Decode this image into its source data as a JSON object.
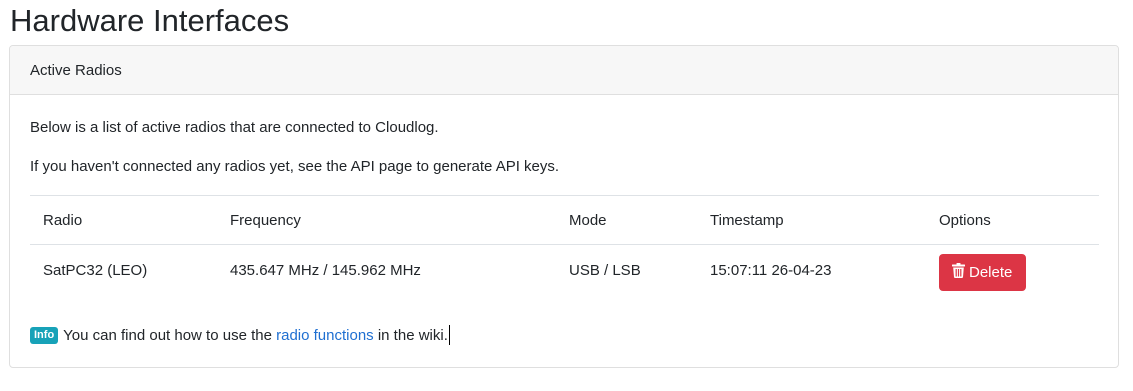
{
  "page": {
    "title": "Hardware Interfaces"
  },
  "card": {
    "header": "Active Radios",
    "intro": "Below is a list of active radios that are connected to Cloudlog.",
    "hint": "If you haven't connected any radios yet, see the API page to generate API keys."
  },
  "table": {
    "headers": [
      "Radio",
      "Frequency",
      "Mode",
      "Timestamp",
      "Options"
    ],
    "rows": [
      {
        "radio": "SatPC32 (LEO)",
        "frequency": "435.647 MHz / 145.962 MHz",
        "mode": "USB / LSB",
        "timestamp": "15:07:11 26-04-23",
        "delete_label": "Delete"
      }
    ]
  },
  "info": {
    "badge": "Info",
    "text_before": "You can find out how to use the ",
    "link": "radio functions",
    "text_after": " in the wiki."
  },
  "colors": {
    "danger": "#dc3545",
    "info": "#17a2b8",
    "link": "#1f6fd1"
  },
  "icons": {
    "delete": "trash-icon"
  }
}
